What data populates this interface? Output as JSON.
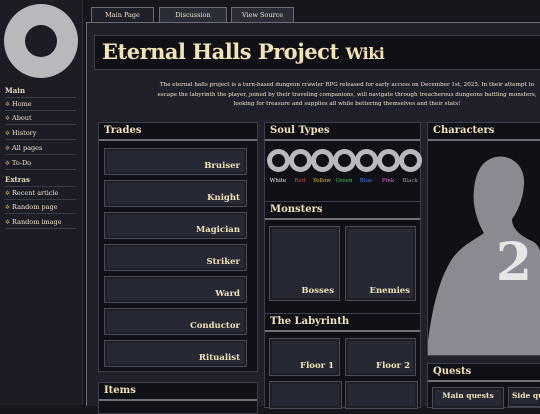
{
  "tabs": [
    "Main Page",
    "Discussion",
    "View Source"
  ],
  "sidebar": {
    "main_heading": "Main",
    "main_items": [
      "Home",
      "About",
      "History",
      "All pages",
      "To-Do"
    ],
    "extras_heading": "Extras",
    "extras_items": [
      "Recent article",
      "Random page",
      "Random image"
    ]
  },
  "page": {
    "title": "Eternal Halls Project",
    "title_suffix": "Wiki",
    "intro": "The eternal halls project is a turn-based dungeon crawler RPG released for early access on December 1st, 2025. In their attempt to escape the labyrinth the player, joined by their traveling companions, will navigate through treacherous dungeons battling monsters, looking for treasure and supplies all while bettering themselves and their stats!"
  },
  "trades": {
    "heading": "Trades",
    "items": [
      "Bruiser",
      "Knight",
      "Magician",
      "Striker",
      "Ward",
      "Conductor",
      "Ritualist"
    ]
  },
  "items_section": {
    "heading": "Items"
  },
  "soul_types": {
    "heading": "Soul Types",
    "souls": [
      {
        "name": "White",
        "color": "#e8e8e8"
      },
      {
        "name": "Red",
        "color": "#e0443a"
      },
      {
        "name": "Yellow",
        "color": "#e6c23a"
      },
      {
        "name": "Green",
        "color": "#4cbf4c"
      },
      {
        "name": "Blue",
        "color": "#4a7ee6"
      },
      {
        "name": "Pink",
        "color": "#e26ad0"
      },
      {
        "name": "Black",
        "color": "#9a9aa2"
      }
    ]
  },
  "monsters": {
    "heading": "Monsters",
    "bosses": "Bosses",
    "enemies": "Enemies"
  },
  "labyrinth": {
    "heading": "The Labyrinth",
    "floor1": "Floor 1",
    "floor2": "Floor 2"
  },
  "characters": {
    "heading": "Characters",
    "mark": "2"
  },
  "quests": {
    "heading": "Quests",
    "main": "Main quests",
    "side": "Side que"
  }
}
